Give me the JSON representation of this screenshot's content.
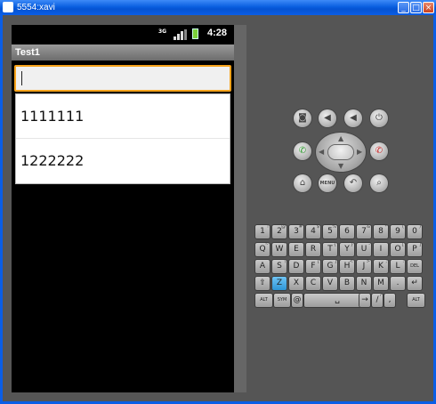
{
  "window": {
    "title": "5554:xavi",
    "minimize_glyph": "_",
    "maximize_glyph": "□",
    "close_glyph": "×"
  },
  "statusbar": {
    "network_label": "3G",
    "time": "4:28"
  },
  "app": {
    "title": "Test1"
  },
  "input": {
    "value": ""
  },
  "dropdown": {
    "items": [
      "1111111",
      "1222222"
    ]
  },
  "hardware": {
    "camera_icon": "camera-icon",
    "volume_down_icon": "volume-down-icon",
    "volume_up_icon": "volume-up-icon",
    "power_icon": "power-icon",
    "call_icon": "call-icon",
    "end_call_icon": "end-call-icon",
    "home_icon": "home-icon",
    "menu_label": "MENU",
    "back_icon": "back-icon",
    "search_icon": "search-icon"
  },
  "keyboard": {
    "row1": [
      {
        "k": "1",
        "s": "!"
      },
      {
        "k": "2",
        "s": "@"
      },
      {
        "k": "3",
        "s": "#"
      },
      {
        "k": "4",
        "s": "$"
      },
      {
        "k": "5",
        "s": "%"
      },
      {
        "k": "6",
        "s": "^"
      },
      {
        "k": "7",
        "s": "&"
      },
      {
        "k": "8",
        "s": "*"
      },
      {
        "k": "9",
        "s": "("
      },
      {
        "k": "0",
        "s": ")"
      }
    ],
    "row2": [
      {
        "k": "Q",
        "s": "~"
      },
      {
        "k": "W",
        "s": "\""
      },
      {
        "k": "E",
        "s": "´"
      },
      {
        "k": "R",
        "s": ""
      },
      {
        "k": "T",
        "s": "{"
      },
      {
        "k": "Y",
        "s": "}"
      },
      {
        "k": "U",
        "s": "-"
      },
      {
        "k": "I",
        "s": ""
      },
      {
        "k": "O",
        "s": "["
      },
      {
        "k": "P",
        "s": "]"
      }
    ],
    "row3": [
      {
        "k": "A",
        "s": ""
      },
      {
        "k": "S",
        "s": "\\"
      },
      {
        "k": "D",
        "s": ""
      },
      {
        "k": "F",
        "s": "["
      },
      {
        "k": "G",
        "s": "]"
      },
      {
        "k": "H",
        "s": "<"
      },
      {
        "k": "J",
        "s": ">"
      },
      {
        "k": "K",
        "s": ";"
      },
      {
        "k": "L",
        "s": ":"
      },
      {
        "k": "DEL",
        "s": ""
      }
    ],
    "row4": [
      {
        "k": "⇧",
        "s": ""
      },
      {
        "k": "Z",
        "s": ""
      },
      {
        "k": "X",
        "s": ""
      },
      {
        "k": "C",
        "s": ""
      },
      {
        "k": "V",
        "s": ""
      },
      {
        "k": "B",
        "s": ""
      },
      {
        "k": "N",
        "s": ""
      },
      {
        "k": "M",
        "s": ""
      },
      {
        "k": ".",
        "s": ""
      },
      {
        "k": "↵",
        "s": ""
      }
    ],
    "row5": {
      "alt_left": "ALT",
      "sym": "SYM",
      "at": "@",
      "space": "␣",
      "arrow": "→",
      "slash": "/",
      "question": "?",
      "comma": ",",
      "alt_right": "ALT"
    }
  }
}
